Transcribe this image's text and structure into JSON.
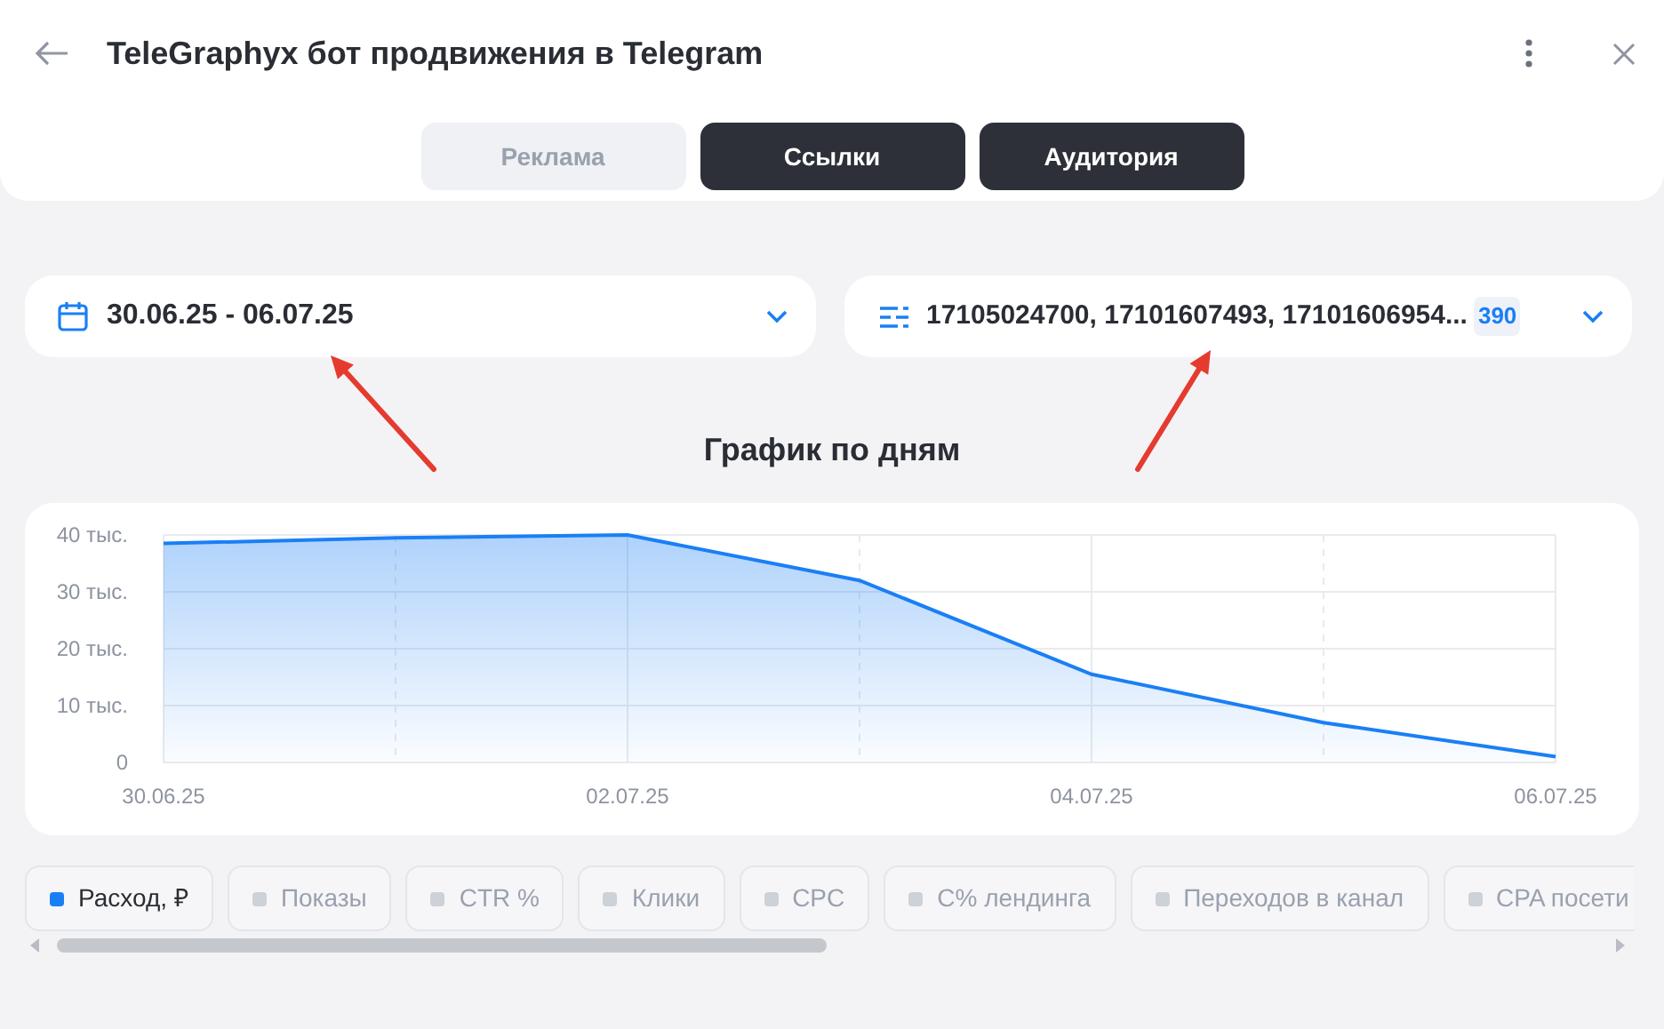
{
  "window": {
    "title": "TeleGraphyx бот продвижения в Telegram"
  },
  "tabs": [
    {
      "label": "Реклама",
      "selected": false
    },
    {
      "label": "Ссылки",
      "selected": true
    },
    {
      "label": "Аудитория",
      "selected": true
    }
  ],
  "date_filter": {
    "value": "30.06.25 - 06.07.25"
  },
  "ids_filter": {
    "value": "17105024700, 17101607493, 17101606954...",
    "count": "390"
  },
  "chart_title": "График по дням",
  "chart_data": {
    "type": "area",
    "grid": true,
    "categories": [
      "30.06.25",
      null,
      "02.07.25",
      null,
      "04.07.25",
      null,
      "06.07.25"
    ],
    "series": [
      {
        "color": "#1a7ff5",
        "values": [
          38.5,
          39.5,
          40,
          32,
          15.5,
          7,
          1
        ]
      }
    ],
    "ylim": [
      0,
      40
    ],
    "yticks": [
      {
        "value": 0,
        "label": "0"
      },
      {
        "value": 10,
        "label": "10 тыс."
      },
      {
        "value": 20,
        "label": "20 тыс."
      },
      {
        "value": 30,
        "label": "30 тыс."
      },
      {
        "value": 40,
        "label": "40 тыс."
      }
    ]
  },
  "metrics": [
    {
      "label": "Расход, ₽",
      "selected": true
    },
    {
      "label": "Показы",
      "selected": false
    },
    {
      "label": "CTR %",
      "selected": false
    },
    {
      "label": "Клики",
      "selected": false
    },
    {
      "label": "CPC",
      "selected": false
    },
    {
      "label": "C% лендинга",
      "selected": false
    },
    {
      "label": "Переходов в канал",
      "selected": false
    },
    {
      "label": "CPA посети",
      "selected": false
    }
  ]
}
